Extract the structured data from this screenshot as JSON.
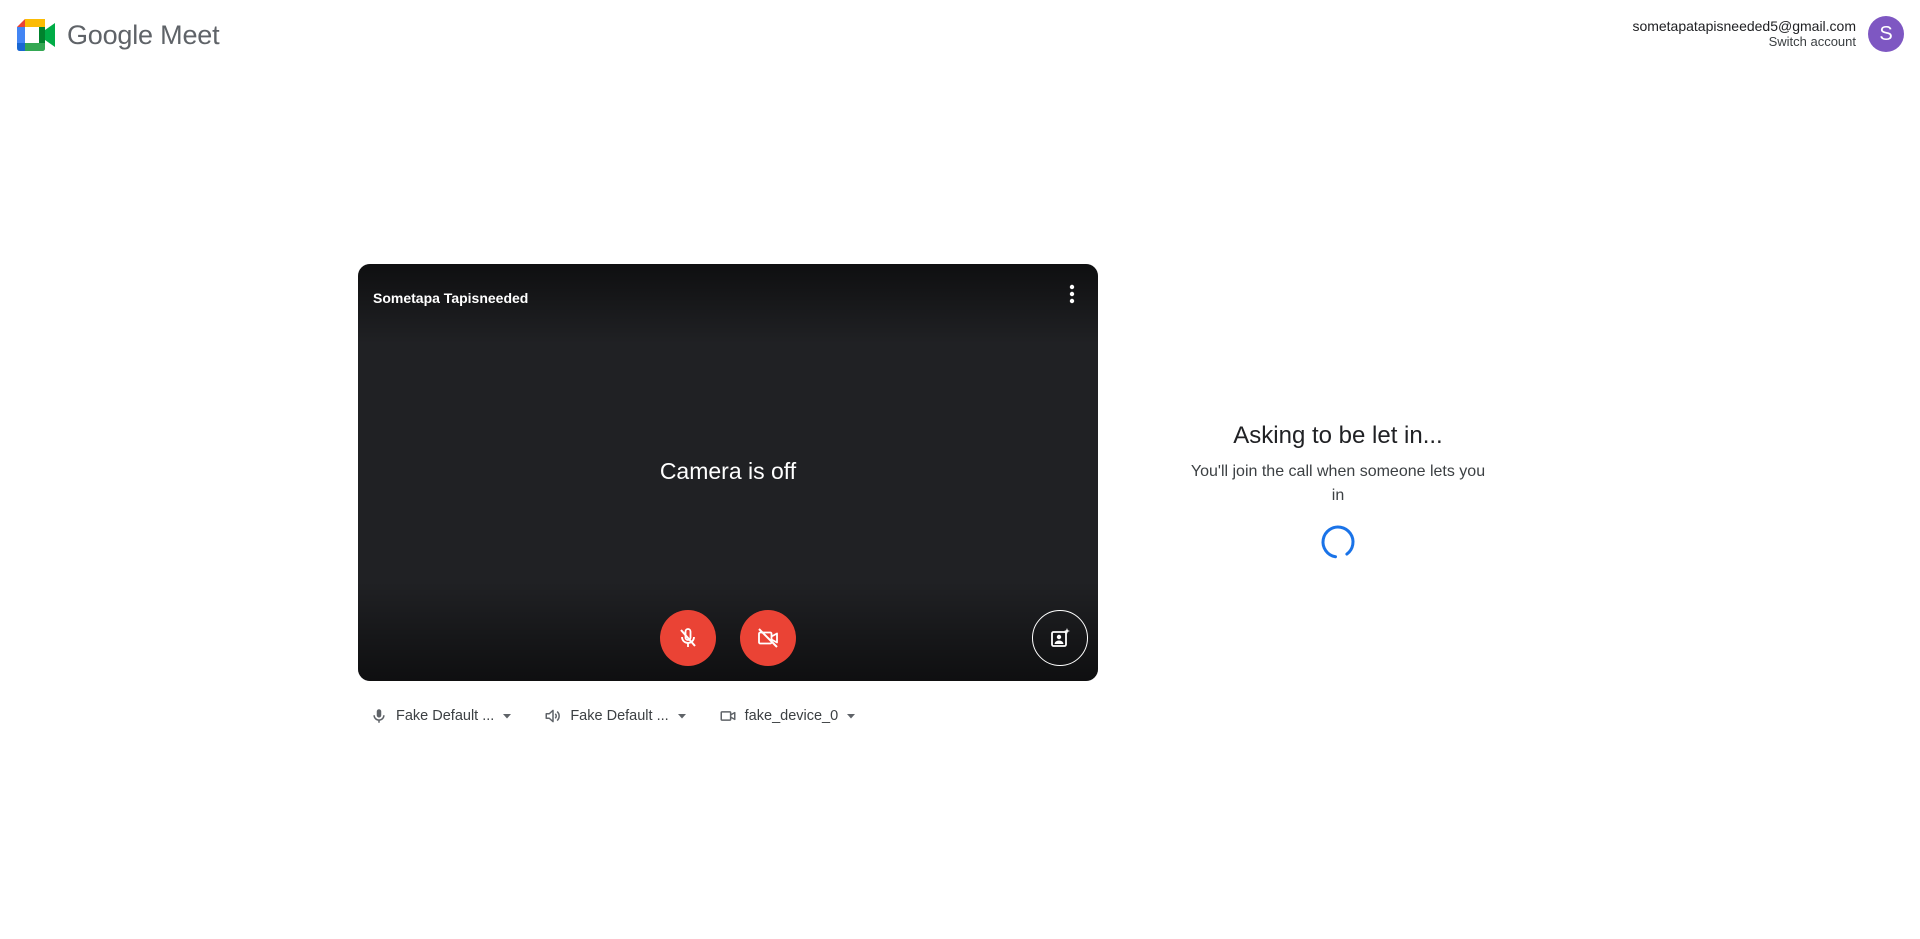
{
  "app": {
    "name": "Google Meet"
  },
  "account": {
    "email": "sometapatapisneeded5@gmail.com",
    "switch_label": "Switch account",
    "avatar_letter": "S",
    "avatar_color": "#7e57c2"
  },
  "preview": {
    "participant_name": "Sometapa Tapisneeded",
    "camera_status": "Camera is off",
    "mic_state": "off",
    "camera_state": "off"
  },
  "devices": {
    "microphone": "Fake Default ...",
    "speaker": "Fake Default ...",
    "camera": "fake_device_0"
  },
  "status": {
    "title": "Asking to be let in...",
    "subtitle": "You'll join the call when someone lets you in"
  },
  "colors": {
    "danger_red": "#ea4335",
    "spinner_blue": "#1a73e8",
    "tile_bg": "#202124"
  }
}
